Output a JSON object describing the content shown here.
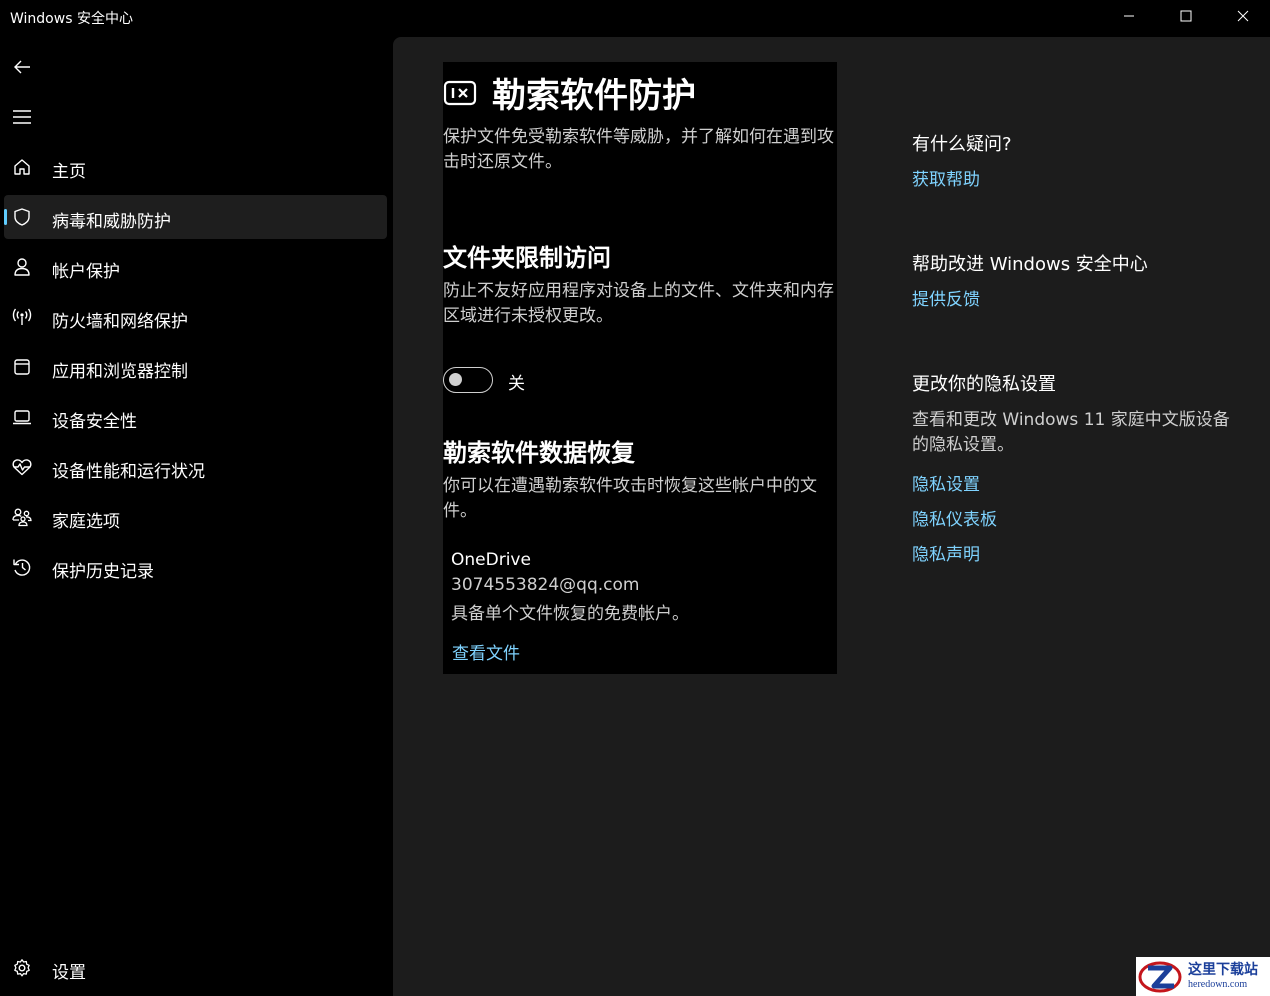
{
  "window": {
    "title": "Windows 安全中心"
  },
  "sidebar": {
    "items": [
      {
        "label": "主页",
        "icon": "home-icon"
      },
      {
        "label": "病毒和威胁防护",
        "icon": "shield-icon",
        "selected": true
      },
      {
        "label": "帐户保护",
        "icon": "person-icon"
      },
      {
        "label": "防火墙和网络保护",
        "icon": "wifi-antenna-icon"
      },
      {
        "label": "应用和浏览器控制",
        "icon": "app-window-icon"
      },
      {
        "label": "设备安全性",
        "icon": "laptop-icon"
      },
      {
        "label": "设备性能和运行状况",
        "icon": "heart-pulse-icon"
      },
      {
        "label": "家庭选项",
        "icon": "family-icon"
      },
      {
        "label": "保护历史记录",
        "icon": "history-icon"
      }
    ],
    "settings_label": "设置"
  },
  "main": {
    "title": "勒索软件防护",
    "description": "保护文件免受勒索软件等威胁，并了解如何在遇到攻击时还原文件。",
    "folder_access": {
      "title": "文件夹限制访问",
      "description": "防止不友好应用程序对设备上的文件、文件夹和内存区域进行未授权更改。",
      "toggle_state": "关",
      "toggle_on": false
    },
    "recovery": {
      "title": "勒索软件数据恢复",
      "description": "你可以在遭遇勒索软件攻击时恢复这些帐户中的文件。",
      "provider": "OneDrive",
      "account": "3074553824@qq.com",
      "plan": "具备单个文件恢复的免费帐户。",
      "view_files_link": "查看文件"
    }
  },
  "right_panel": {
    "question_heading": "有什么疑问?",
    "get_help_link": "获取帮助",
    "improve_heading": "帮助改进 Windows 安全中心",
    "feedback_link": "提供反馈",
    "privacy_heading": "更改你的隐私设置",
    "privacy_text": "查看和更改 Windows 11 家庭中文版设备的隐私设置。",
    "privacy_links": [
      "隐私设置",
      "隐私仪表板",
      "隐私声明"
    ]
  },
  "watermark": {
    "cn": "这里下载站",
    "en": "heredown.com"
  },
  "colors": {
    "background": "#000000",
    "content_background": "#1c1c1c",
    "selected_nav": "#1e1e1e",
    "accent": "#60cdff",
    "link": "#7fd3ff"
  }
}
